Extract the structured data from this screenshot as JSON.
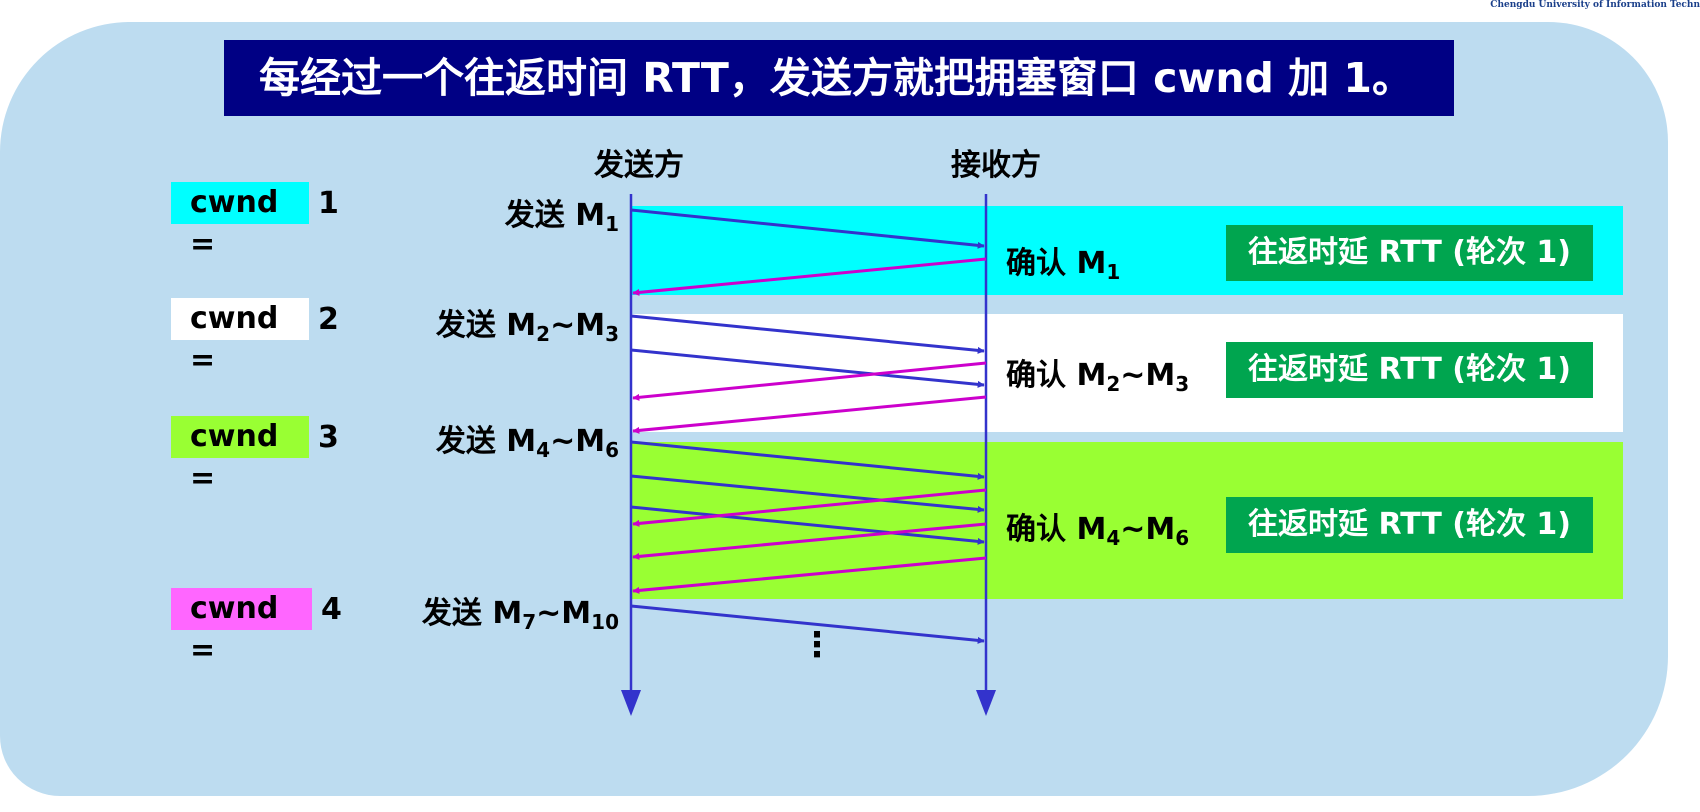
{
  "watermark": "Chengdu University of Information Techn",
  "title": "每经过一个往返时间 RTT，发送方就把拥塞窗口 cwnd 加 1。",
  "sender_label": "发送方",
  "receiver_label": "接收方",
  "colors": {
    "panel": "#bddcf0",
    "title_bg": "#000084",
    "data_arrow": "#3333cc",
    "ack_arrow": "#cc00cc",
    "round1": "#00ffff",
    "round2": "#ffffff",
    "round3": "#99ff33",
    "round4": "#ff66ff",
    "rtt_badge": "#00a54f"
  },
  "rounds": [
    {
      "cwnd_label": "cwnd =",
      "cwnd_value": "1",
      "send_prefix": "发送 M",
      "send_from": "1",
      "send_to": "",
      "ack_prefix": "确认 M",
      "ack_from": "1",
      "ack_to": "",
      "rtt_label": "往返时延 RTT (轮次 1)"
    },
    {
      "cwnd_label": "cwnd =",
      "cwnd_value": "2",
      "send_prefix": "发送 M",
      "send_from": "2",
      "send_mid": "~M",
      "send_to": "3",
      "ack_prefix": "确认 M",
      "ack_from": "2",
      "ack_mid": "~M",
      "ack_to": "3",
      "rtt_label": "往返时延 RTT (轮次 1)"
    },
    {
      "cwnd_label": "cwnd =",
      "cwnd_value": "3",
      "send_prefix": "发送 M",
      "send_from": "4",
      "send_mid": "~M",
      "send_to": "6",
      "ack_prefix": "确认 M",
      "ack_from": "4",
      "ack_mid": "~M",
      "ack_to": "6",
      "rtt_label": "往返时延 RTT (轮次 1)"
    },
    {
      "cwnd_label": "cwnd =",
      "cwnd_value": "4",
      "send_prefix": "发送 M",
      "send_from": "7",
      "send_mid": "~M",
      "send_to": "10"
    }
  ],
  "ellipsis": "⋮"
}
